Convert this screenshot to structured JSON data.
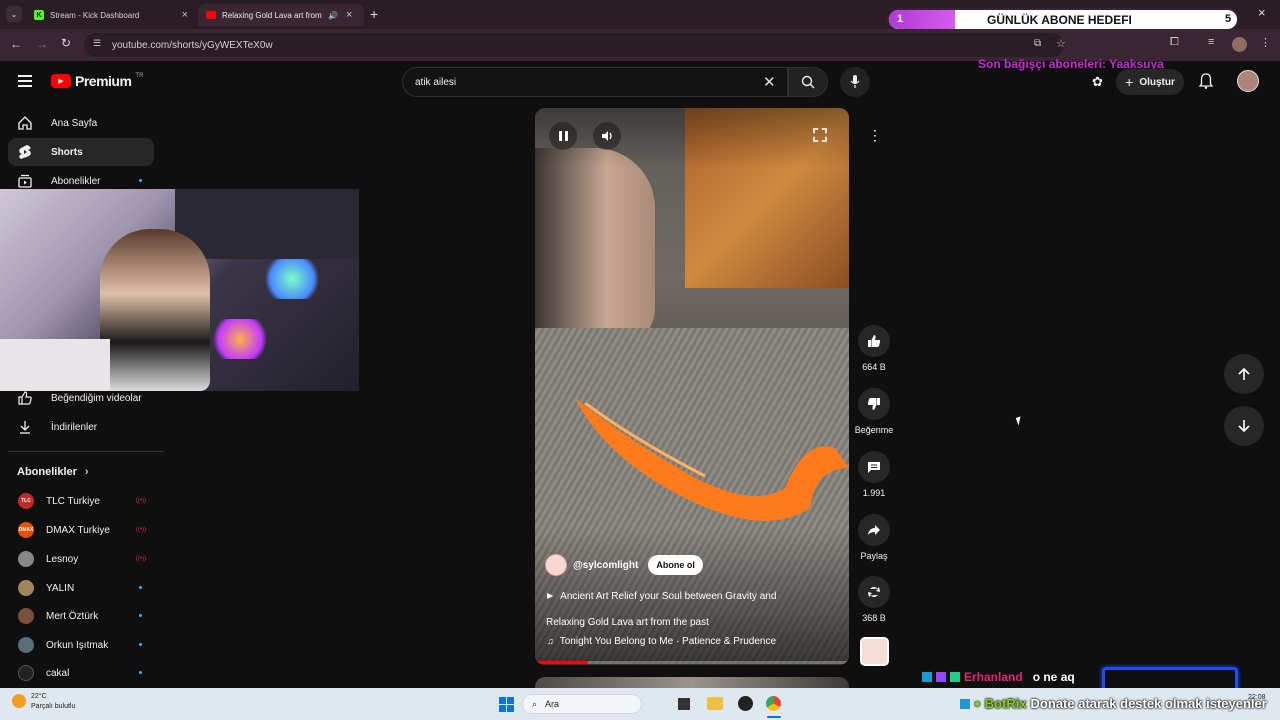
{
  "browser": {
    "tabs": [
      {
        "title": "Stream - Kick Dashboard",
        "active": false
      },
      {
        "title": "Relaxing Gold Lava art from t",
        "active": true
      }
    ],
    "url": "youtube.com/shorts/yGyWEXTeX0w"
  },
  "overlay": {
    "goal_current": "1",
    "goal_title": "GÜNLÜK ABONE HEDEFI",
    "goal_target": "5",
    "last_donor": "Son bağışçı aboneleri: Yaaksuya",
    "chat_user": "Erhanland",
    "chat_msg": "o ne aq",
    "botrix_label": "BotRix",
    "botrix_ticker": "Donate atarak destek olmak isteyenler"
  },
  "youtube": {
    "logo_text": "Premium",
    "logo_suffix": "TR",
    "search_value": "atik ailesi",
    "create_label": "Oluştur",
    "nav": [
      {
        "label": "Ana Sayfa",
        "icon": "home-icon"
      },
      {
        "label": "Shorts",
        "icon": "shorts-icon"
      },
      {
        "label": "Abonelikler",
        "icon": "subscriptions-icon"
      }
    ],
    "nav_lower": [
      {
        "label": "Beğendiğim videolar",
        "icon": "like-icon"
      },
      {
        "label": "İndirilenler",
        "icon": "download-icon"
      }
    ],
    "subs_header": "Abonelikler",
    "subs": [
      {
        "name": "TLC Turkiye",
        "badge": "TLC",
        "color": "#c62828",
        "status": "live"
      },
      {
        "name": "DMAX Turkiye",
        "badge": "DMAX",
        "color": "#e65100",
        "status": "live"
      },
      {
        "name": "Lesnoy",
        "badge": "",
        "color": "#888888",
        "status": "live"
      },
      {
        "name": "YALIN",
        "badge": "",
        "color": "#a0855b",
        "status": "dot"
      },
      {
        "name": "Mert Öztürk",
        "badge": "",
        "color": "#7d4e3a",
        "status": "dot"
      },
      {
        "name": "Orkun Işıtmak",
        "badge": "",
        "color": "#5b6d7a",
        "status": "dot"
      },
      {
        "name": "cakal",
        "badge": "",
        "color": "#222222",
        "status": "dot"
      }
    ],
    "short": {
      "channel": "@sylcomlight",
      "subscribe_label": "Abone ol",
      "desc_line1": "Ancient Art Relief your Soul between Gravity and",
      "desc_line2": "Relaxing Gold Lava art from the past",
      "music": "Tonight You Belong to Me · Patience & Prudence",
      "progress": 0.17
    },
    "actions": {
      "likes": "664 B",
      "dislike": "Beğenme",
      "comments": "1.991",
      "share": "Paylaş",
      "remix": "368 B"
    }
  },
  "taskbar": {
    "temp": "22°C",
    "weather": "Parçalı bulutlu",
    "search_placeholder": "Ara",
    "time": "22:08"
  }
}
